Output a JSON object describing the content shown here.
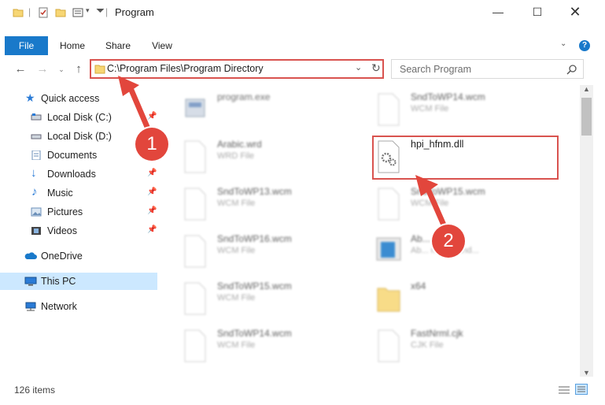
{
  "window": {
    "title": "Program"
  },
  "ribbon": {
    "tabs": [
      "File",
      "Home",
      "Share",
      "View"
    ],
    "help_label": "?"
  },
  "address": {
    "path": "C:\\Program Files\\Program Directory"
  },
  "search": {
    "placeholder": "Search Program"
  },
  "sidebar": {
    "items": [
      {
        "label": "Quick access",
        "icon": "star-icon"
      },
      {
        "label": "Local Disk (C:)",
        "icon": "drive-icon"
      },
      {
        "label": "Local Disk (D:)",
        "icon": "drive-icon"
      },
      {
        "label": "Documents",
        "icon": "documents-icon"
      },
      {
        "label": "Downloads",
        "icon": "download-icon"
      },
      {
        "label": "Music",
        "icon": "music-icon"
      },
      {
        "label": "Pictures",
        "icon": "pictures-icon"
      },
      {
        "label": "Videos",
        "icon": "videos-icon"
      },
      {
        "label": "OneDrive",
        "icon": "cloud-icon"
      },
      {
        "label": "This PC",
        "icon": "computer-icon"
      },
      {
        "label": "Network",
        "icon": "network-icon"
      }
    ]
  },
  "files": [
    {
      "name": "program.exe",
      "type": ""
    },
    {
      "name": "SndToWP14.wcm",
      "type": "WCM File"
    },
    {
      "name": "Arabic.wrd",
      "type": "WRD File"
    },
    {
      "name": "hpi_hfnm.dll",
      "type": ""
    },
    {
      "name": "SndToWP13.wcm",
      "type": "WCM File"
    },
    {
      "name": "SndToWP15.wcm",
      "type": "WCM File"
    },
    {
      "name": "SndToWP16.wcm",
      "type": "WCM File"
    },
    {
      "name": "Ab... .exe",
      "type": "Ab... ment hand..."
    },
    {
      "name": "SndToWP15.wcm",
      "type": "WCM File"
    },
    {
      "name": "x64",
      "type": ""
    },
    {
      "name": "SndToWP14.wcm",
      "type": "WCM File"
    },
    {
      "name": "FastNrml.cjk",
      "type": "CJK File"
    }
  ],
  "status": {
    "item_count": "126 items"
  },
  "annotations": {
    "step1": "1",
    "step2": "2"
  },
  "colors": {
    "accent": "#1979ca",
    "highlight": "#d9534f",
    "arrow": "#e2463c",
    "selected": "#cce8ff"
  }
}
